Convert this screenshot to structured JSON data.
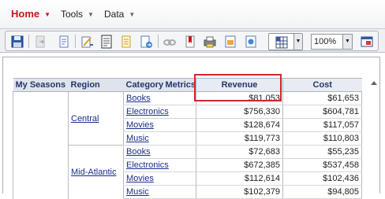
{
  "menubar": {
    "home": "Home",
    "tools": "Tools",
    "data": "Data"
  },
  "toolbar": {
    "zoom_value": "100%",
    "icons": [
      "save-icon",
      "export-icon",
      "page-icon",
      "design-icon",
      "document-icon",
      "note-icon",
      "document-arrow-icon",
      "link-icon",
      "bookmark-icon",
      "print-icon",
      "image-export-icon",
      "pdf-export-icon",
      "pivot-icon",
      "window-icon"
    ]
  },
  "grid": {
    "headers": {
      "season": "My Seasons",
      "region": "Region",
      "category": "Category",
      "metrics": "Metrics",
      "revenue": "Revenue",
      "cost": "Cost"
    },
    "groups": [
      {
        "region": "Central",
        "rows": [
          {
            "category": "Books",
            "revenue": "$81,053",
            "cost": "$61,653"
          },
          {
            "category": "Electronics",
            "revenue": "$756,330",
            "cost": "$604,781"
          },
          {
            "category": "Movies",
            "revenue": "$128,674",
            "cost": "$117,057"
          },
          {
            "category": "Music",
            "revenue": "$119,773",
            "cost": "$110,803"
          }
        ]
      },
      {
        "region": "Mid-Atlantic",
        "rows": [
          {
            "category": "Books",
            "revenue": "$72,683",
            "cost": "$55,235"
          },
          {
            "category": "Electronics",
            "revenue": "$672,385",
            "cost": "$537,458"
          },
          {
            "category": "Movies",
            "revenue": "$112,614",
            "cost": "$102,436"
          },
          {
            "category": "Music",
            "revenue": "$102,379",
            "cost": "$94,805"
          }
        ]
      }
    ]
  },
  "colors": {
    "accent": "#c7161d",
    "header_text": "#24356b",
    "link": "#1b2e8a",
    "highlight_border": "#d0282c"
  }
}
